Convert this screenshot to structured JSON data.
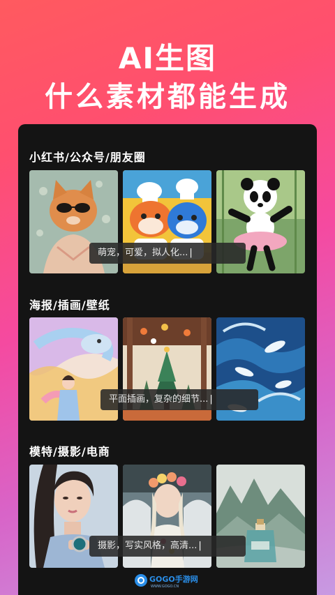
{
  "header": {
    "line1": "AI生图",
    "line2": "什么素材都能生成"
  },
  "sections": [
    {
      "title": "小红书/公众号/朋友圈",
      "prompt": "萌宠，可爱，拟人化...",
      "images": [
        "cat-with-sunglasses",
        "fox-and-cat-chefs",
        "dancing-panda"
      ]
    },
    {
      "title": "海报/插画/壁纸",
      "prompt": "平面插画，复杂的细节...",
      "images": [
        "rainbow-dragon-girl",
        "forest-christmas-tree",
        "blue-wave-fish"
      ]
    },
    {
      "title": "模特/摄影/电商",
      "prompt": "摄影，写实风格，高清...",
      "images": [
        "model-with-watch",
        "flower-crown-girl",
        "perfume-bottle-landscape"
      ]
    }
  ],
  "watermark": {
    "brand": "GOGO手游网",
    "url": "WWW.GOGO.CN"
  },
  "colors": {
    "bg_top": "#ff5a5f",
    "bg_mid": "#f54aa0",
    "bg_bottom": "#c79ae2",
    "panel": "#141414"
  }
}
